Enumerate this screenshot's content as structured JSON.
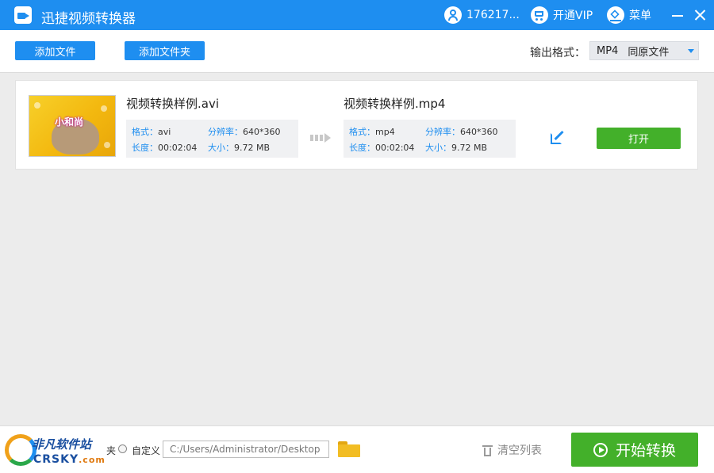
{
  "titlebar": {
    "app_title": "迅捷视频转换器",
    "user_id": "176217...",
    "vip_label": "开通VIP",
    "menu_label": "菜单"
  },
  "toolbar": {
    "add_file_label": "添加文件",
    "add_folder_label": "添加文件夹",
    "output_format_label": "输出格式：",
    "output_format_value": "MP4",
    "output_quality_value": "同原文件"
  },
  "files": [
    {
      "thumbnail_text": "小和尚",
      "source": {
        "name": "视频转换样例.avi",
        "format_key": "格式：",
        "format_val": "avi",
        "resolution_key": "分辨率：",
        "resolution_val": "640*360",
        "duration_key": "长度：",
        "duration_val": "00:02:04",
        "size_key": "大小：",
        "size_val": "9.72 MB"
      },
      "target": {
        "name": "视频转换样例.mp4",
        "format_key": "格式：",
        "format_val": "mp4",
        "resolution_key": "分辨率：",
        "resolution_val": "640*360",
        "duration_key": "长度：",
        "duration_val": "00:02:04",
        "size_key": "大小：",
        "size_val": "9.72 MB"
      },
      "open_label": "打开"
    }
  ],
  "bottom": {
    "output_dir_fragment": "夹",
    "custom_label": "自定义",
    "path_value": "C:/Users/Administrator/Desktop",
    "clear_list_label": "清空列表",
    "start_label": "开始转换"
  },
  "watermark": {
    "line1": "非凡软件站",
    "line2": "CRSKY",
    "line2_suffix": ".com"
  },
  "colors": {
    "primary_blue": "#1e8ef0",
    "action_green": "#43b02a",
    "background_gray": "#ececec"
  }
}
